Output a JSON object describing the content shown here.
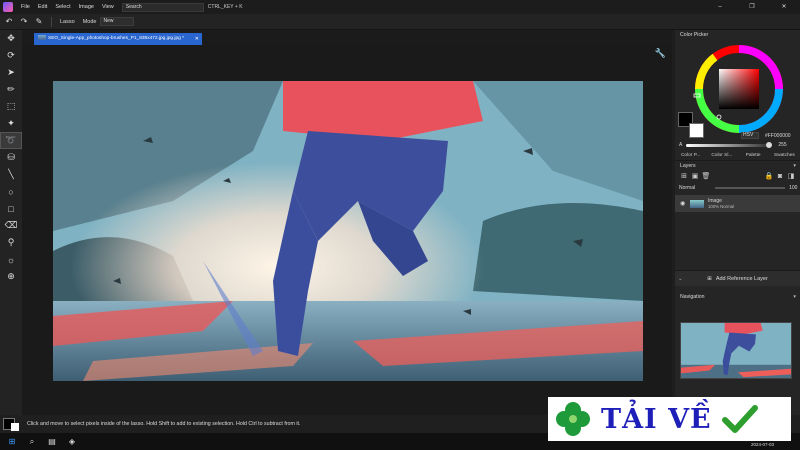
{
  "menubar": {
    "items": [
      "File",
      "Edit",
      "Select",
      "Image",
      "View"
    ],
    "search_placeholder": "Search",
    "search_shortcut": "CTRL_KEY + K",
    "controls": [
      "–",
      "❐",
      "✕"
    ]
  },
  "options": {
    "tool_label": "Lasso",
    "mode_label": "Mode",
    "mode_value": "New"
  },
  "document": {
    "tab_title": "SEO_Single-App_photoshop-brushes_P1_838x472.jpg.jpg.jpg *"
  },
  "color_picker": {
    "title": "Color Picker",
    "mode": "HSV",
    "hex": "#FF000000",
    "alpha_label": "A",
    "alpha_value": "255",
    "tabs": [
      "Color P...",
      "Color Sl...",
      "Palette",
      "Swatches"
    ],
    "foreground": "#000000",
    "background": "#ffffff"
  },
  "layers": {
    "title": "Layers",
    "blend_mode": "Normal",
    "opacity": "100",
    "items": [
      {
        "name": "Image",
        "detail": "100% Normal"
      }
    ],
    "add_reference": "Add Reference Layer"
  },
  "navigator": {
    "title": "Navigation"
  },
  "status": {
    "message": "Click and move to select pixels inside of the lasso. Hold Shift to add to existing selection. Hold Ctrl to subtract from it."
  },
  "taskbar": {
    "date": "2024-07-03"
  },
  "watermark": {
    "text": "TẢI VỀ"
  }
}
